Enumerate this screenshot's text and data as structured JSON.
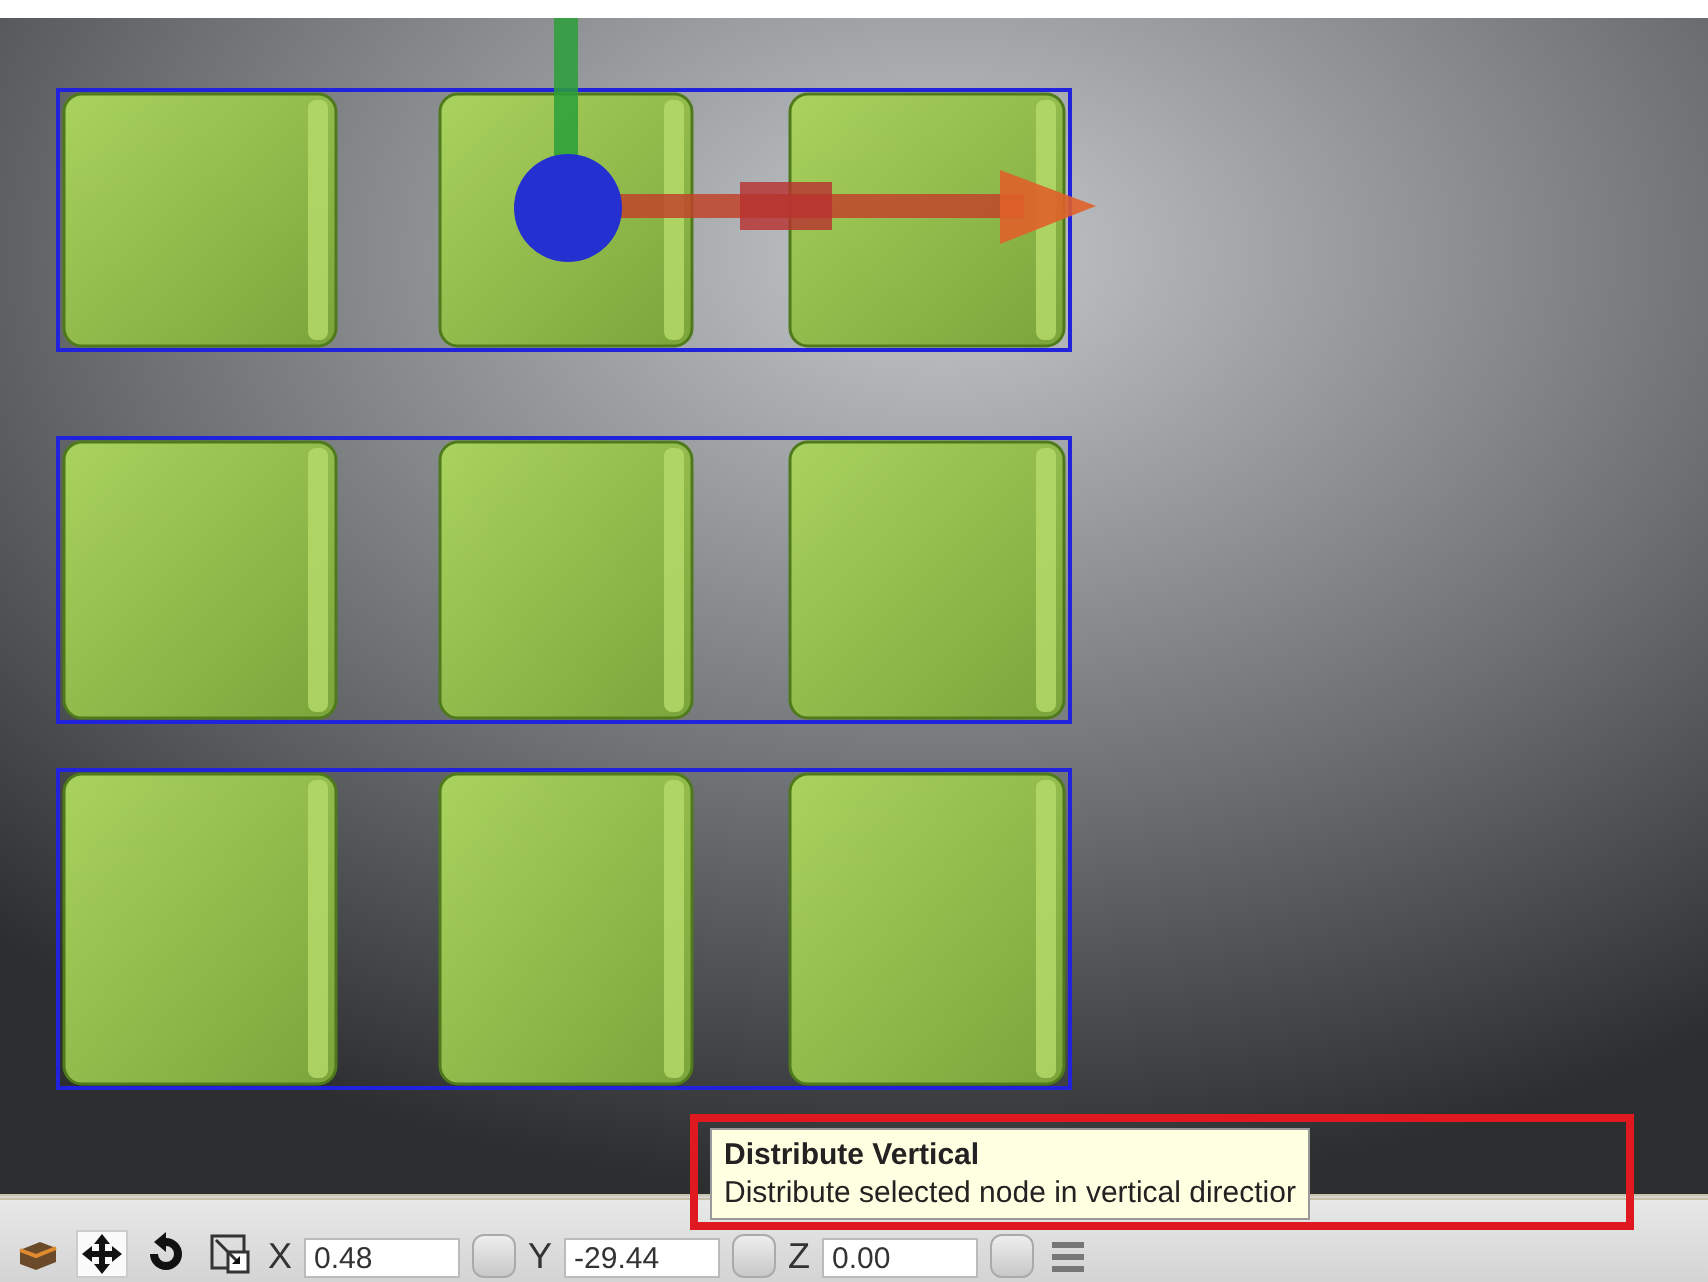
{
  "tooltip": {
    "title": "Distribute Vertical",
    "description": "Distribute selected node in vertical directior",
    "highlighted": true
  },
  "toolbar": {
    "tools": [
      {
        "kind": "cube",
        "selected": false
      },
      {
        "kind": "move",
        "selected": true
      },
      {
        "kind": "rotate",
        "selected": false
      },
      {
        "kind": "scale",
        "selected": false
      }
    ],
    "coordinates": [
      {
        "axis": "X",
        "value": "0.48"
      },
      {
        "axis": "Y",
        "value": "-29.44"
      },
      {
        "axis": "Z",
        "value": "0.00"
      }
    ]
  }
}
